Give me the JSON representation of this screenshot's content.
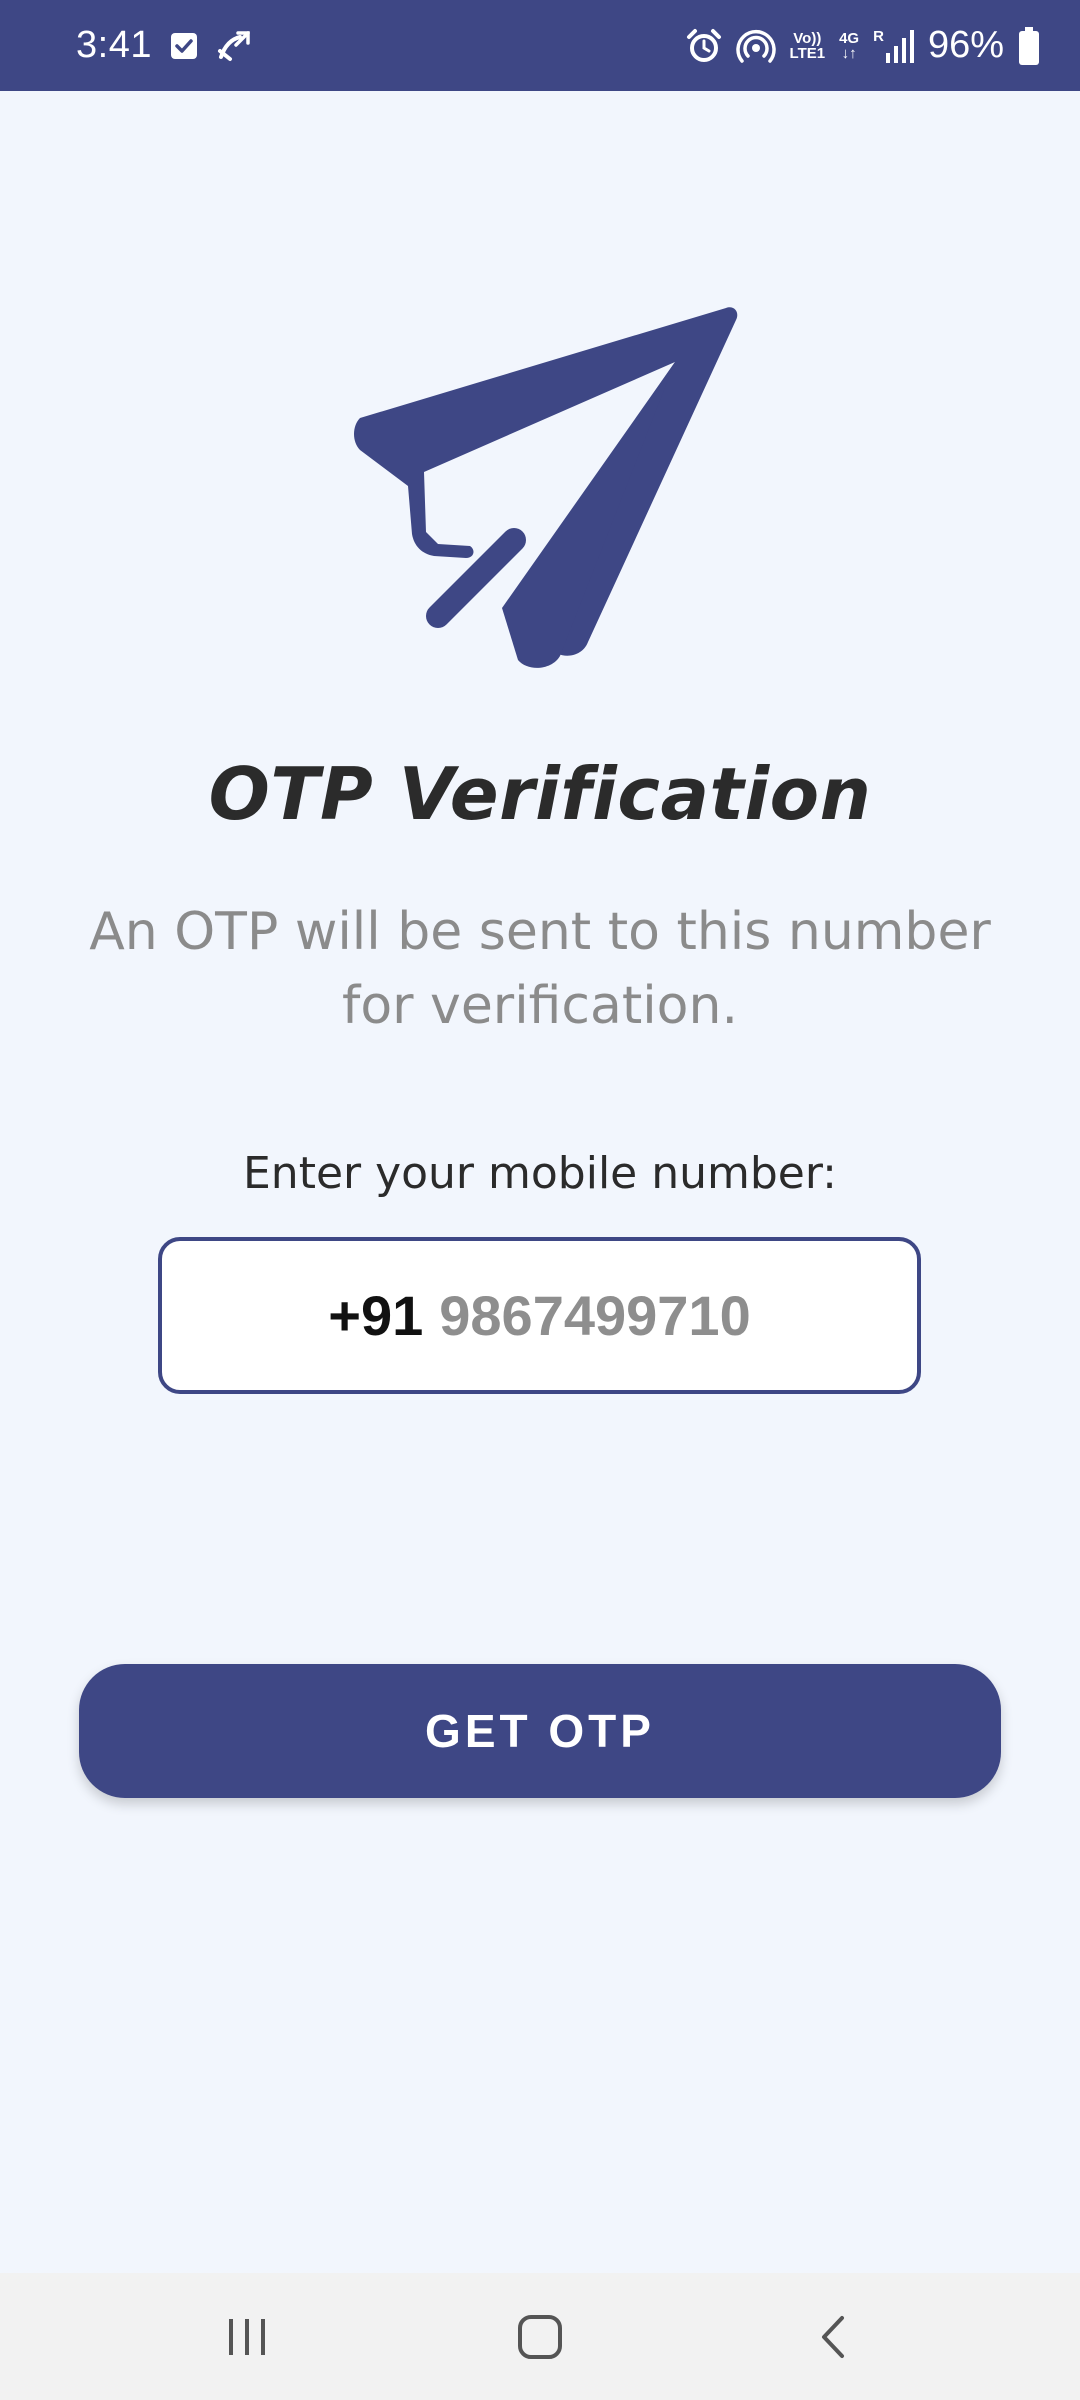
{
  "status_bar": {
    "time": "3:41",
    "battery_percent": "96%",
    "net_top": "Vo))",
    "net_bottom": "LTE1",
    "lte_label": "4G",
    "roaming_label": "R",
    "icons": [
      "checkbox-notification-icon",
      "missed-call-icon",
      "alarm-icon",
      "hotspot-icon",
      "volte-icon",
      "4g-icon",
      "signal-icon",
      "battery-icon"
    ],
    "background_color": "#3e4785"
  },
  "hero": {
    "icon": "paper-plane-send-icon",
    "color": "#3e4785"
  },
  "title": "OTP Verification",
  "subtitle": "An OTP will be sent to this number for verification.",
  "phone_label": "Enter your mobile number:",
  "phone_input": {
    "country_code": "+91",
    "placeholder": "9867499710"
  },
  "get_otp_button": "GET OTP",
  "nav_bar": {
    "icons": [
      "recent-apps-icon",
      "home-icon",
      "back-icon"
    ]
  },
  "colors": {
    "accent": "#3e4785",
    "background": "#f2f6fd",
    "text_primary": "#2b2b2b",
    "text_secondary": "#8b8b8b"
  }
}
